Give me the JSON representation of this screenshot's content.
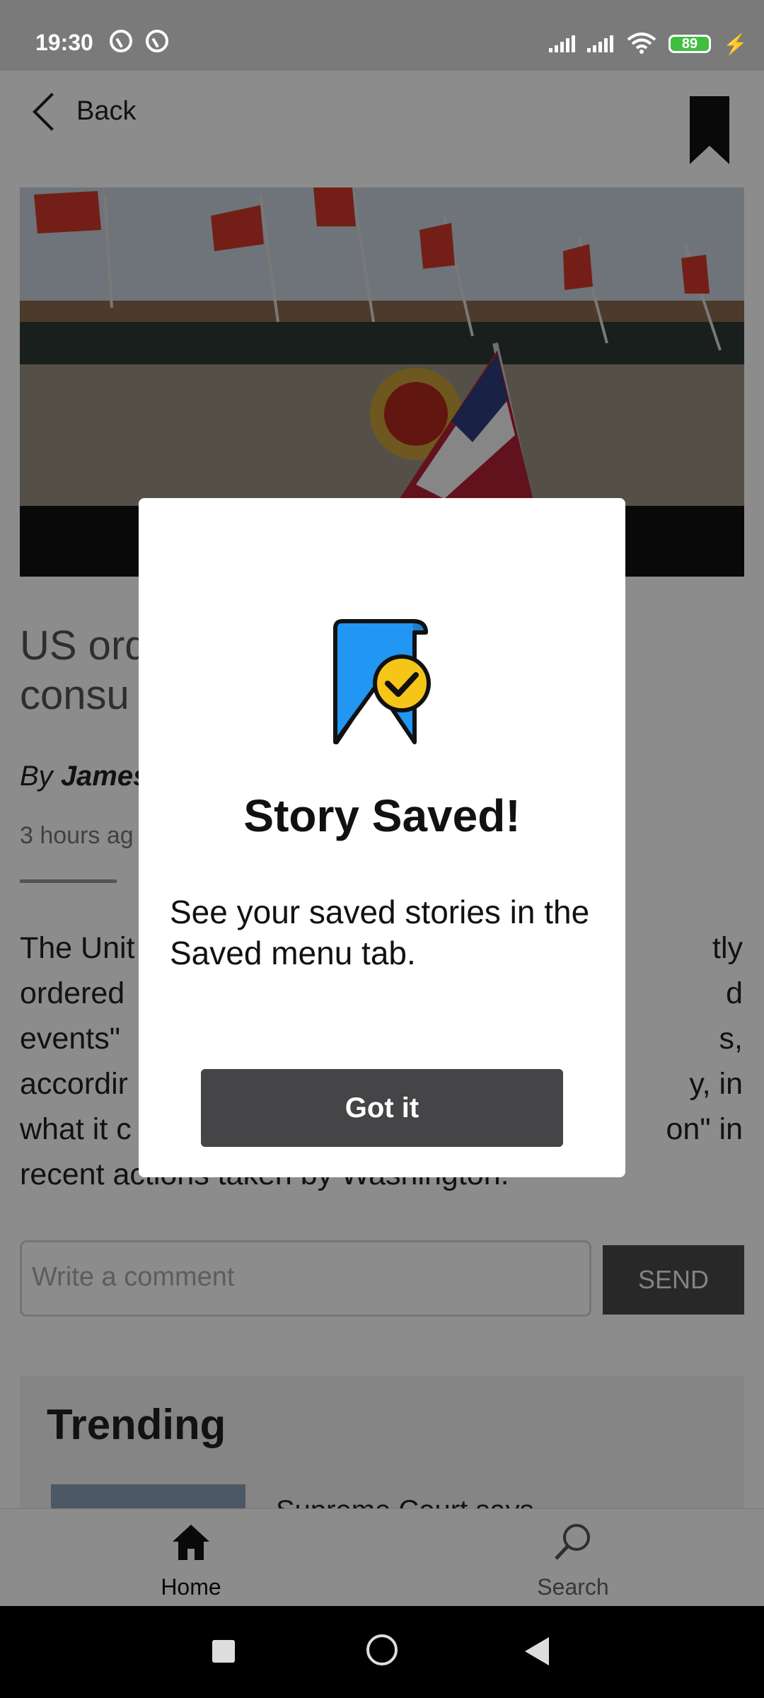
{
  "status_bar": {
    "time": "19:30",
    "battery_level": "89"
  },
  "header": {
    "back_label": "Back"
  },
  "article": {
    "headline_visible": "US ord\nconsu",
    "byline_prefix": "By",
    "byline_author_visible": "James",
    "timestamp_visible": "3 hours ag",
    "body_lines_visible": [
      "The Unit",
      "ordered",
      "events\"",
      "accordir",
      "what it c",
      "recent actions taken by Washington."
    ],
    "body_right_fragments": [
      "tly",
      "d",
      "s,",
      "y, in",
      "on\" in"
    ]
  },
  "comment": {
    "placeholder": "Write a comment",
    "send_label": "SEND"
  },
  "trending": {
    "title": "Trending",
    "first_item_text": "Supreme Court says"
  },
  "bottom_nav": {
    "items": [
      {
        "label": "Home",
        "icon": "home-icon",
        "active": true
      },
      {
        "label": "Search",
        "icon": "search-icon",
        "active": false
      }
    ]
  },
  "modal": {
    "title": "Story Saved!",
    "message": "See your saved stories in the Saved menu tab.",
    "button_label": "Got it",
    "icon": "bookmark-check-icon",
    "icon_colors": {
      "ribbon": "#2196f3",
      "check_badge": "#f5c518"
    }
  },
  "colors": {
    "scrim": "rgba(0,0,0,0.45)",
    "button_dark": "#454548",
    "statusbar_bg": "#7a7a7a"
  }
}
